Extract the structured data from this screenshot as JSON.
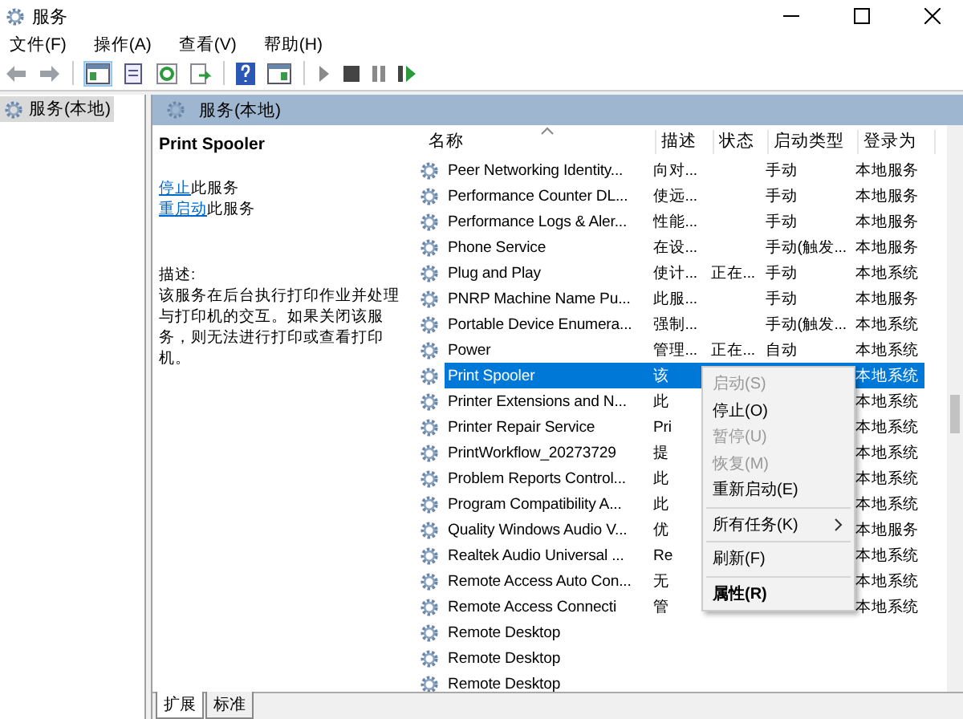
{
  "window": {
    "title": "服务"
  },
  "menu": [
    "文件(F)",
    "操作(A)",
    "查看(V)",
    "帮助(H)"
  ],
  "tree": [
    {
      "label": "服务(本地)",
      "selected": true
    }
  ],
  "panel_header": "服务(本地)",
  "details": {
    "service_name": "Print Spooler",
    "actions": [
      {
        "link": "停止",
        "text": "此服务"
      },
      {
        "link": "重启动",
        "text": "此服务"
      }
    ],
    "description_label": "描述:",
    "description": "该服务在后台执行打印作业并处理与打印机的交互。如果关闭该服务，则无法进行打印或查看打印机。"
  },
  "table": {
    "columns": [
      "名称",
      "描述",
      "状态",
      "启动类型",
      "登录为"
    ],
    "rows": [
      {
        "name": "Peer Networking Identity...",
        "description": "向对...",
        "startup_type": "手动",
        "logon": "本地服务",
        "selected": false
      },
      {
        "name": "Performance Counter DL...",
        "description": "使远...",
        "startup_type": "手动",
        "logon": "本地服务",
        "selected": false
      },
      {
        "name": "Performance Logs & Aler...",
        "description": "性能...",
        "startup_type": "手动",
        "logon": "本地服务",
        "selected": false
      },
      {
        "name": "Phone Service",
        "description": "在设...",
        "startup_type": "手动(触发...",
        "logon": "本地服务",
        "selected": false
      },
      {
        "name": "Plug and Play",
        "description": "使计...",
        "status": "正在...",
        "startup_type": "手动",
        "logon": "本地系统",
        "selected": false
      },
      {
        "name": "PNRP Machine Name Pu...",
        "description": "此服...",
        "startup_type": "手动",
        "logon": "本地服务",
        "selected": false
      },
      {
        "name": "Portable Device Enumera...",
        "description": "强制...",
        "startup_type": "手动(触发...",
        "logon": "本地系统",
        "selected": false
      },
      {
        "name": "Power",
        "description": "管理...",
        "status": "正在...",
        "startup_type": "自动",
        "logon": "本地系统",
        "selected": false
      },
      {
        "name": "Print Spooler",
        "description": "该",
        "logon": "本地系统",
        "selected": true
      },
      {
        "name": "Printer Extensions and N...",
        "description": "此",
        "logon": "本地系统",
        "selected": false
      },
      {
        "name": "Printer Repair Service",
        "description": "Pri",
        "logon": "本地系统",
        "selected": false
      },
      {
        "name": "PrintWorkflow_20273729",
        "description": "提",
        "logon": "本地系统",
        "selected": false
      },
      {
        "name": "Problem Reports Control...",
        "description": "此",
        "logon": "本地系统",
        "selected": false
      },
      {
        "name": "Program Compatibility A...",
        "description": "此",
        "logon": "本地系统",
        "selected": false
      },
      {
        "name": "Quality Windows Audio V...",
        "description": "优",
        "logon": "本地服务",
        "selected": false
      },
      {
        "name": "Realtek Audio Universal ...",
        "description": "Re",
        "logon": "本地系统",
        "selected": false
      },
      {
        "name": "Remote Access Auto Con...",
        "description": "无",
        "logon": "本地系统",
        "selected": false
      },
      {
        "name": "Remote Access Connecti",
        "description": "管",
        "logon": "本地系统",
        "selected": false
      },
      {
        "name": "Remote Desktop",
        "selected": false
      },
      {
        "name": "Remote Desktop",
        "selected": false
      },
      {
        "name": "Remote Desktop",
        "selected": false
      }
    ]
  },
  "context_menu": [
    {
      "kind": "item",
      "label": "启动(S)",
      "disabled": true,
      "default": false
    },
    {
      "kind": "item",
      "label": "停止(O)",
      "disabled": false,
      "default": false
    },
    {
      "kind": "item",
      "label": "暂停(U)",
      "disabled": true,
      "default": false
    },
    {
      "kind": "item",
      "label": "恢复(M)",
      "disabled": true,
      "default": false
    },
    {
      "kind": "item",
      "label": "重新启动(E)",
      "disabled": false,
      "default": false
    },
    {
      "kind": "separator"
    },
    {
      "kind": "submenu",
      "label": "所有任务(K)",
      "disabled": false,
      "default": false
    },
    {
      "kind": "separator"
    },
    {
      "kind": "item",
      "label": "刷新(F)",
      "disabled": false,
      "default": false
    },
    {
      "kind": "separator"
    },
    {
      "kind": "item",
      "label": "属性(R)",
      "disabled": false,
      "default": true
    }
  ],
  "tabs": [
    {
      "label": "扩展",
      "selected": true
    },
    {
      "label": "标准",
      "selected": false
    }
  ]
}
